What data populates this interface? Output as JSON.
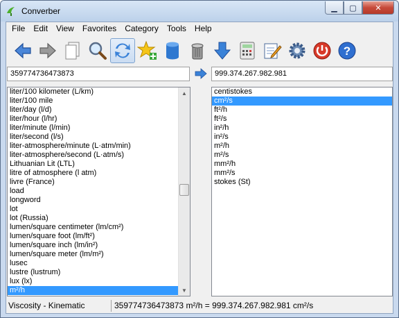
{
  "window": {
    "title": "Converber"
  },
  "menu": [
    "File",
    "Edit",
    "View",
    "Favorites",
    "Category",
    "Tools",
    "Help"
  ],
  "toolbar": {
    "buttons": [
      {
        "name": "back-button",
        "icon": "back-arrow-icon"
      },
      {
        "name": "forward-button",
        "icon": "forward-arrow-icon"
      },
      {
        "name": "copy-button",
        "icon": "copy-pages-icon"
      },
      {
        "name": "search-button",
        "icon": "magnifier-icon"
      },
      {
        "name": "swap-button",
        "icon": "swap-arrows-icon",
        "active": true
      },
      {
        "name": "add-favorite-button",
        "icon": "star-add-icon"
      },
      {
        "name": "database-button",
        "icon": "database-icon"
      },
      {
        "name": "trash-button",
        "icon": "trash-can-icon"
      },
      {
        "name": "download-button",
        "icon": "down-arrow-icon"
      },
      {
        "name": "calculator-button",
        "icon": "calculator-icon"
      },
      {
        "name": "edit-button",
        "icon": "notepad-pencil-icon"
      },
      {
        "name": "settings-button",
        "icon": "gear-icon"
      },
      {
        "name": "power-button",
        "icon": "power-icon"
      },
      {
        "name": "help-button",
        "icon": "help-icon"
      }
    ]
  },
  "input": {
    "value": "359774736473873"
  },
  "output": {
    "value": "999.374.267.982.981"
  },
  "from_units": [
    "liter/100 kilometer (L/km)",
    "liter/100 mile",
    "liter/day (l/d)",
    "liter/hour (l/hr)",
    "liter/minute (l/min)",
    "liter/second (l/s)",
    "liter-atmosphere/minute (L·atm/min)",
    "liter-atmosphere/second (L·atm/s)",
    "Lithuanian Lit (LTL)",
    "litre of atmosphere (l atm)",
    "livre (France)",
    "load",
    "longword",
    "lot",
    "lot (Russia)",
    "lumen/square centimeter (lm/cm²)",
    "lumen/square foot (lm/ft²)",
    "lumen/square inch (lm/in²)",
    "lumen/square meter (lm/m²)",
    "lusec",
    "lustre (lustrum)",
    "lux (lx)",
    "m²/h"
  ],
  "from_selected_index": 22,
  "to_units": [
    "centistokes",
    "cm²/s",
    "ft²/h",
    "ft²/s",
    "in²/h",
    "in²/s",
    "m²/h",
    "m²/s",
    "mm²/h",
    "mm²/s",
    "stokes (St)"
  ],
  "to_selected_index": 1,
  "status": {
    "category": "Viscosity - Kinematic",
    "result": "359774736473873 m²/h = 999.374.267.982.981 cm²/s"
  },
  "colors": {
    "selection": "#3399ff",
    "accent": "#1e6fd0"
  }
}
